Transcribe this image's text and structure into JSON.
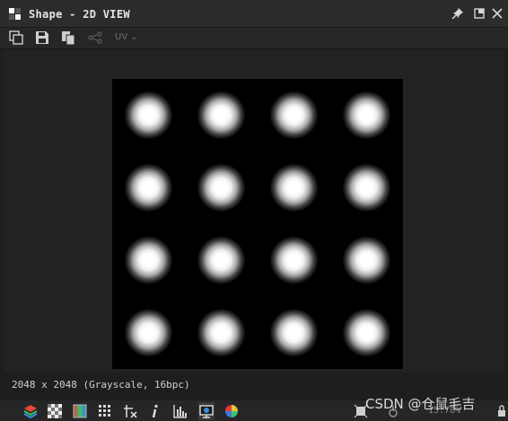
{
  "window": {
    "title": "Shape - 2D VIEW",
    "icon": "checker-grid-icon"
  },
  "title_buttons": [
    "pin-icon",
    "maximize-icon",
    "close-icon"
  ],
  "toolbar": {
    "buttons": [
      "export-icon",
      "save-icon",
      "copy-icon",
      "share-icon"
    ],
    "uv_label": "UV"
  },
  "viewport": {
    "texture": {
      "rows": 4,
      "cols": 4,
      "blob_color": "#ffffff",
      "background_color": "#000000"
    }
  },
  "status": {
    "info": "2048 x 2048 (Grayscale, 16bpc)",
    "zoom": "15.78%"
  },
  "bottom_toolbar": {
    "buttons": [
      "layers-icon",
      "transparency-icon",
      "color-gradient-icon",
      "grid-icon",
      "tiling-icon",
      "info-icon",
      "histogram-icon",
      "display-icon",
      "color-wheel-icon",
      "fit-icon",
      "sync-icon",
      "lock-icon"
    ]
  },
  "watermark": "CSDN @仓鼠毛吉",
  "colors": {
    "title_bg": "#2c2c2c",
    "toolbar_bg": "#262626",
    "viewport_bg": "#222222",
    "accent_blue": "#4a90e2"
  }
}
